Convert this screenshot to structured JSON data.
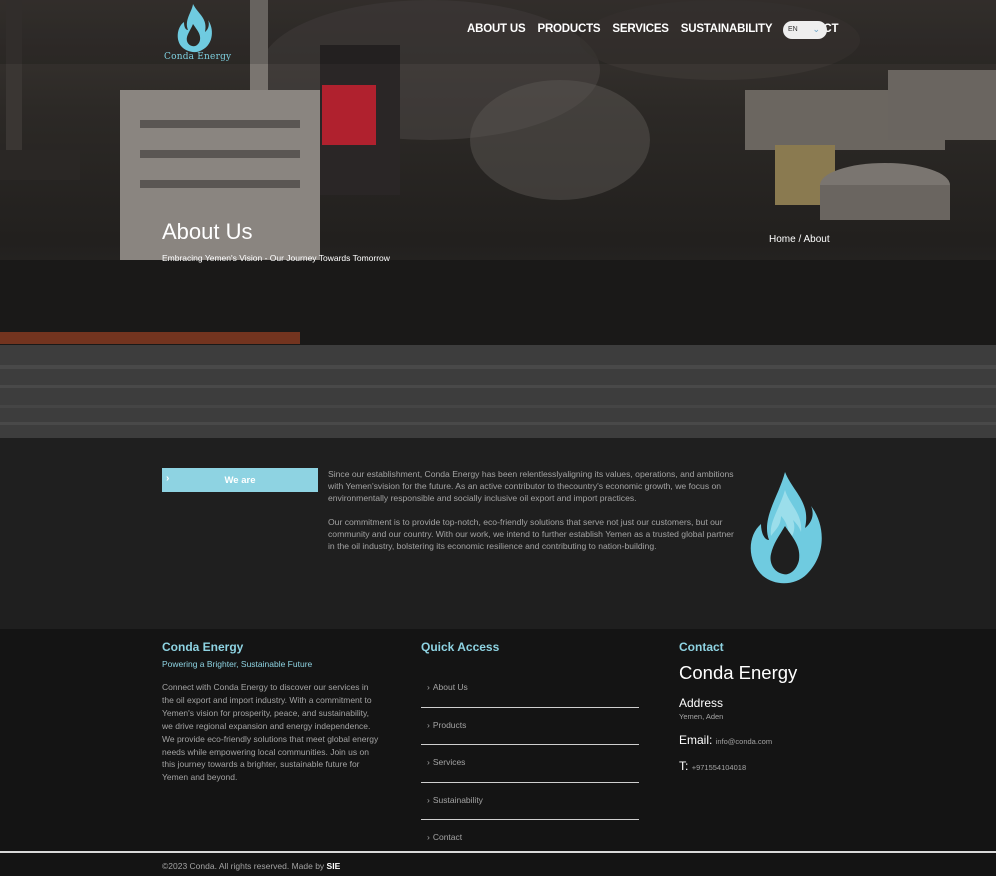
{
  "brand": {
    "name": "Conda Energy",
    "logo_icon": "flame-drop-icon",
    "accent": "#8ed3e2"
  },
  "nav": {
    "items": [
      "ABOUT US",
      "PRODUCTS",
      "SERVICES",
      "SUSTAINABILITY",
      "CONTACT"
    ],
    "language": "EN"
  },
  "hero": {
    "title": "About Us",
    "subtitle": "Embracing Yemen's Vision - Our Journey Towards Tomorrow",
    "breadcrumb": "Home / About"
  },
  "about": {
    "section_label": "We are",
    "paragraph1": "Since our establishment, Conda Energy has been relentlesslyaligning its values, operations, and ambitions with Yemen'svision for the future. As an active contributor to thecountry's economic growth, we focus on environmentally responsible and socially inclusive oil export and import practices.",
    "paragraph2": "Our commitment is to provide top-notch, eco-friendly solutions that serve not just our customers, but our community and our country. With our work, we intend to further establish Yemen as a trusted global partner in the oil industry, bolstering its economic resilience and contributing to nation-building."
  },
  "footer": {
    "brand_title": "Conda Energy",
    "tagline": "Powering a Brighter, Sustainable Future",
    "description": "Connect with Conda Energy to discover our services in the oil export and import industry. With a commitment to Yemen's vision for prosperity, peace, and sustainability, we drive regional expansion and energy independence. We provide eco-friendly solutions that meet global energy needs while empowering local communities. Join us on this journey towards a brighter, sustainable future for Yemen and beyond.",
    "quick_access_title": "Quick Access",
    "quick_links": [
      "About Us",
      "Products",
      "Services",
      "Sustainability",
      "Contact"
    ],
    "contact_title": "Contact",
    "company": "Conda Energy",
    "address_label": "Address",
    "address": "Yemen, Aden",
    "email_label": "Email:",
    "email": "info@conda.com",
    "phone_label": "T:",
    "phone": "+971554104018"
  },
  "copyright": {
    "text": "©2023 Conda. All rights reserved. Made by ",
    "made_by": "SIE"
  }
}
